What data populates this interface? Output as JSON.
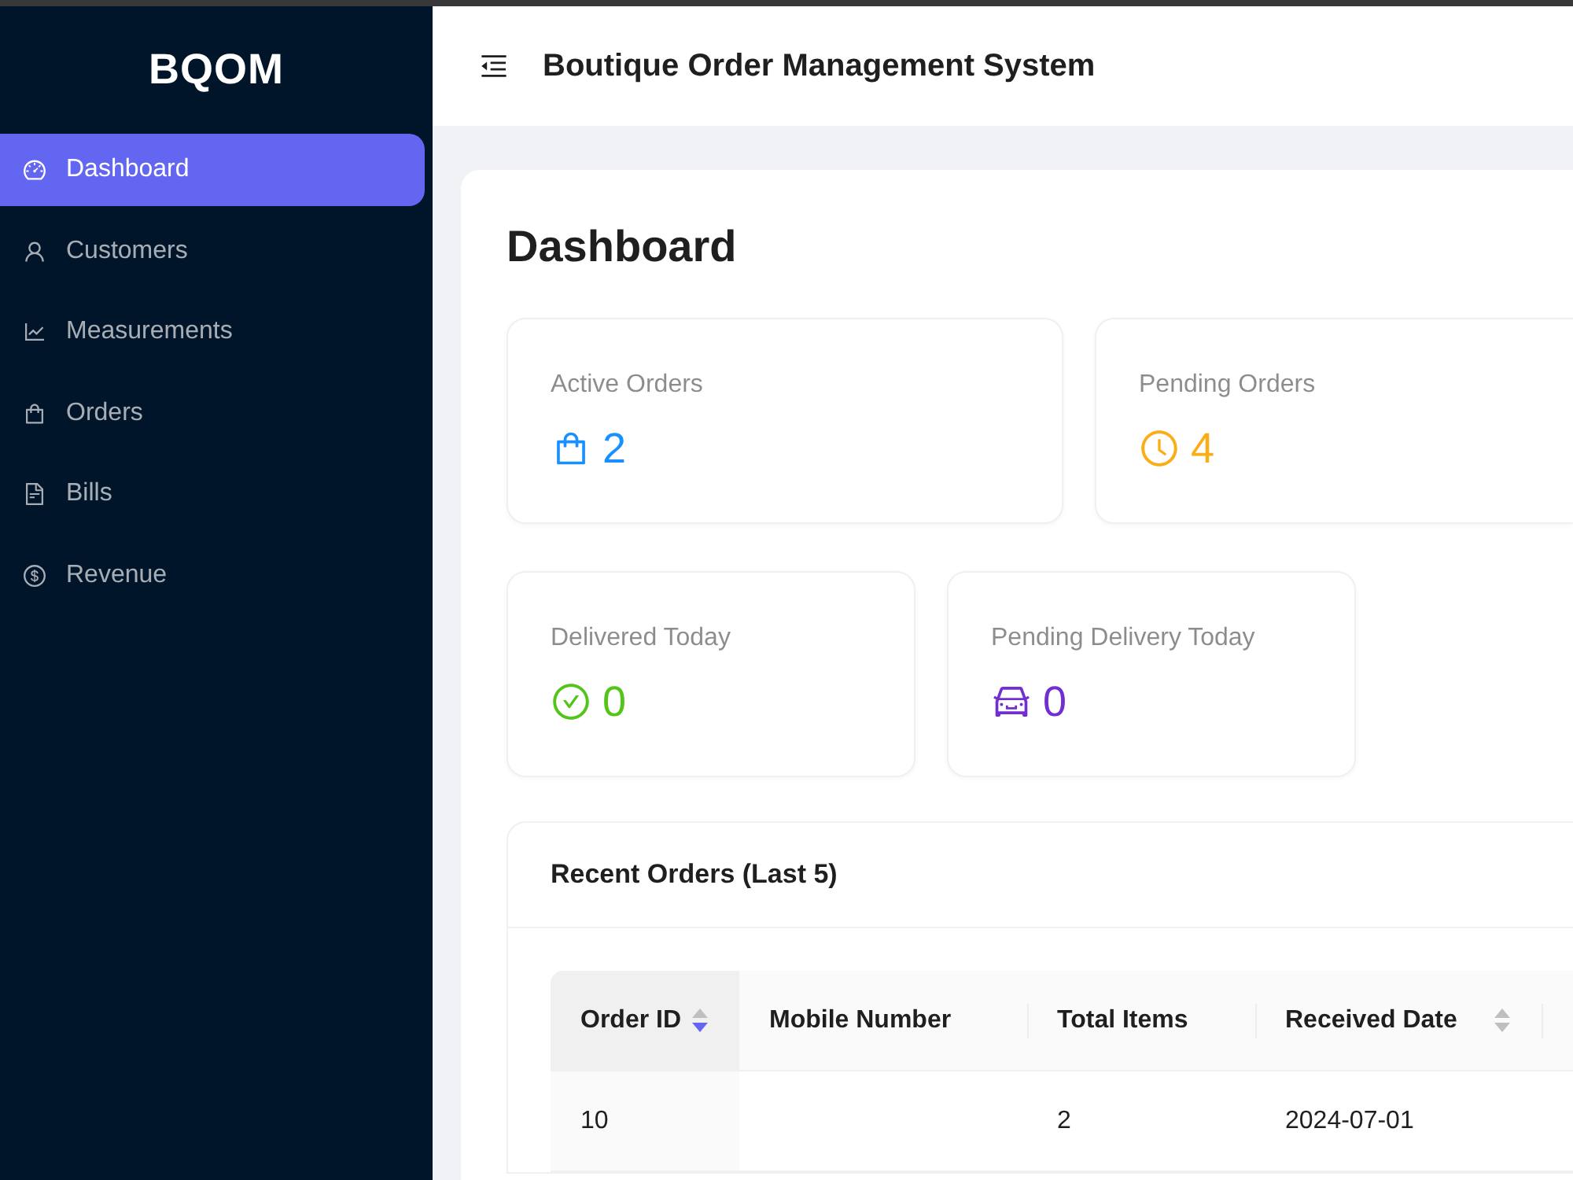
{
  "sidebar": {
    "logo": "BQOM",
    "items": [
      {
        "label": "Dashboard",
        "selected": true
      },
      {
        "label": "Customers",
        "selected": false
      },
      {
        "label": "Measurements",
        "selected": false
      },
      {
        "label": "Orders",
        "selected": false
      },
      {
        "label": "Bills",
        "selected": false
      },
      {
        "label": "Revenue",
        "selected": false
      }
    ]
  },
  "header": {
    "title": "Boutique Order Management System"
  },
  "page": {
    "title": "Dashboard"
  },
  "stats": [
    {
      "label": "Active Orders",
      "value": "2",
      "color": "#1890ff"
    },
    {
      "label": "Pending Orders",
      "value": "4",
      "color": "#faad14"
    },
    {
      "label": "Delivered Today",
      "value": "0",
      "color": "#52c41a"
    },
    {
      "label": "Pending Delivery Today",
      "value": "0",
      "color": "#722ed1"
    }
  ],
  "recent_orders": {
    "title": "Recent Orders (Last 5)",
    "columns": [
      {
        "label": "Order ID",
        "sortable": true,
        "sorted_ascending": false,
        "sorted_descending": true
      },
      {
        "label": "Mobile Number",
        "sortable": false
      },
      {
        "label": "Total Items",
        "sortable": false
      },
      {
        "label": "Received Date",
        "sortable": true,
        "sorted_ascending": false,
        "sorted_descending": false
      }
    ],
    "rows": [
      {
        "order_id": "10",
        "total_items": "2",
        "received_date": "2024-07-01"
      }
    ]
  }
}
